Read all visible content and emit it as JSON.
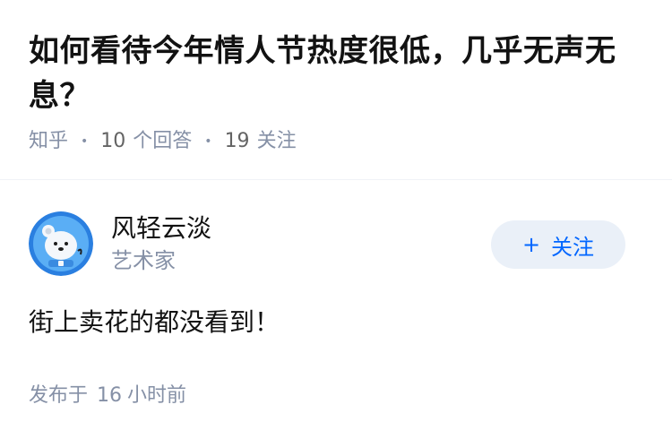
{
  "question": {
    "title": "如何看待今年情人节热度很低，几乎无声无息？",
    "source": "知乎",
    "answer_count": "10",
    "answer_label": "个回答",
    "follower_count": "19",
    "follower_label": "关注"
  },
  "answer": {
    "author": {
      "name": "风轻云淡",
      "headline": "艺术家",
      "avatar_icon": "bear-avatar-icon"
    },
    "follow_button": {
      "plus": "+",
      "label": "关注"
    },
    "content": "街上卖花的都没看到！",
    "time": {
      "prefix": "发布于",
      "value": "16",
      "suffix": "小时前"
    }
  },
  "colors": {
    "title": "#121212",
    "meta": "#8590a6",
    "accent": "#0066ff",
    "follow_bg": "#eaf0f8"
  }
}
